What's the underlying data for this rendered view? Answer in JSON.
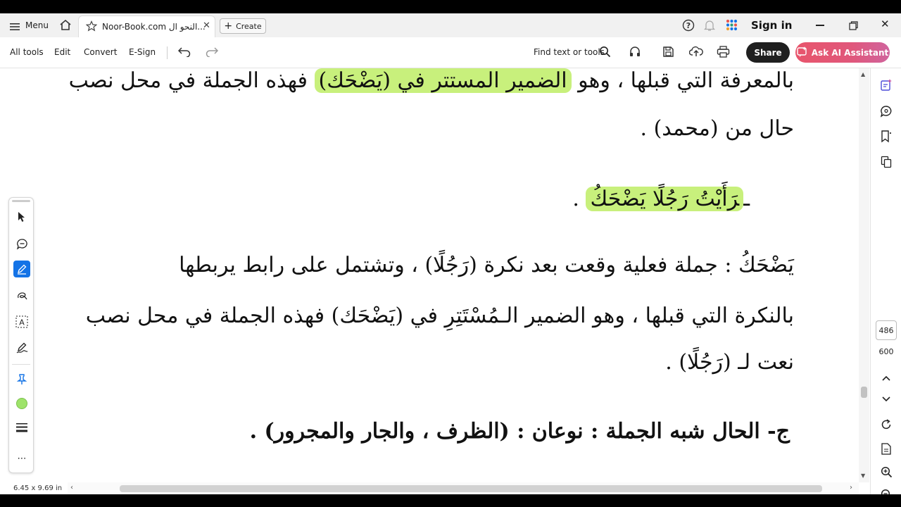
{
  "titlebar": {
    "menu_label": "Menu",
    "tab_title": "Noor-Book.com  النحو ال...",
    "create_label": "Create",
    "signin_label": "Sign in"
  },
  "toolbar": {
    "items": [
      "All tools",
      "Edit",
      "Convert",
      "E-Sign"
    ],
    "find_label": "Find text or tools",
    "share_label": "Share",
    "ai_label": "Ask AI Assistant"
  },
  "document": {
    "lines": [
      {
        "pre": "بالمعرفة التي قبلها ، وهو ",
        "hl": "الضمير المستتر في (يَضْحَك)",
        "post": " فهذه الجملة في محل نصب"
      },
      {
        "pre": "حال من (محمد) .",
        "hl": "",
        "post": ""
      },
      {
        "pre": "ـ",
        "hl": "رَأَيْتُ رَجُلًا يَضْحَكُ",
        "post": " ."
      },
      {
        "pre": "يَضْحَكُ : جملة فعلية وقعت بعد نكرة (رَجُلًا) ، وتشتمل على رابط يربطها",
        "hl": "",
        "post": ""
      },
      {
        "pre": "بالنكرة التي قبلها ، وهو الضمير الـمُسْتَتِرِ في (يَضْحَك) فهذه الجملة في محل نصب",
        "hl": "",
        "post": ""
      },
      {
        "pre": "نعت لـ (رَجُلًا) .",
        "hl": "",
        "post": ""
      },
      {
        "pre": "ج- الحال شبه الجملة : نوعان : (الظرف ، والجار والمجرور) .",
        "hl": "",
        "post": ""
      }
    ]
  },
  "status": {
    "page_size": "6.45 x 9.69 in",
    "page_current": "486",
    "page_total": "600"
  },
  "colors": {
    "highlight": "#c8f07c",
    "accent": "#1473e6",
    "share_bg": "#1f1f1f"
  }
}
